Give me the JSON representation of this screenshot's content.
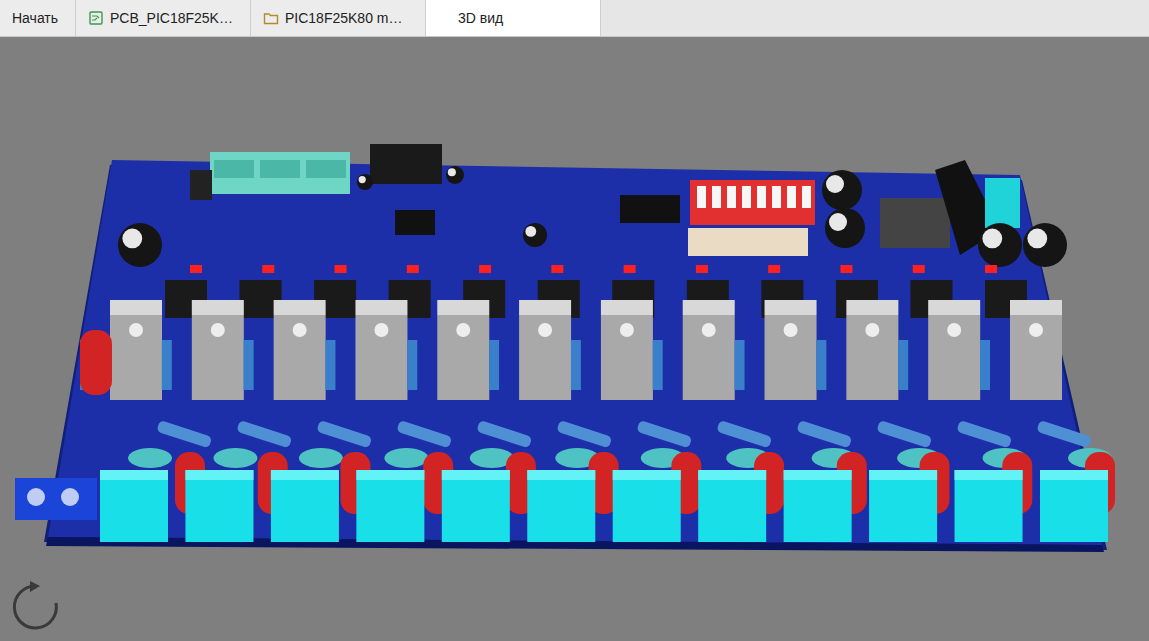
{
  "tabs": [
    {
      "label": "Начать",
      "selected": false,
      "kind": "plain"
    },
    {
      "label": "PCB_PIC18F25K…",
      "selected": false,
      "kind": "pcb"
    },
    {
      "label": "PIC18F25K80 m…",
      "selected": false,
      "kind": "folder"
    },
    {
      "label": "3D вид",
      "selected": true,
      "kind": "plain"
    }
  ]
}
